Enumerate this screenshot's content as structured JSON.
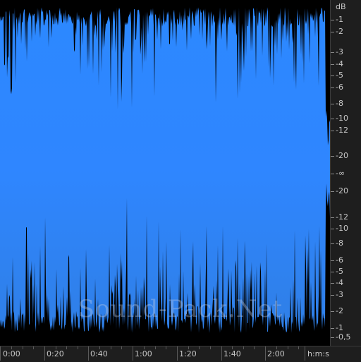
{
  "editor": {
    "watermark": "Sound-Pack.Net",
    "wave_color": "#2f86ff",
    "wave_color_top": "#2c88ff",
    "wave_color_bottom": "#2f7fe6",
    "background_color": "#000000"
  },
  "db_ruler": {
    "unit_label": "dB",
    "upper": [
      "-1",
      "-2",
      "-3",
      "-4",
      "-5",
      "-6",
      "-8",
      "-10",
      "-12",
      "-20"
    ],
    "center": "-∞",
    "lower": [
      "-20",
      "-12",
      "-10",
      "-8",
      "-6",
      "-5",
      "-4",
      "-3",
      "-2",
      "-1",
      "-0,5"
    ]
  },
  "time_ruler": {
    "unit_label": "h:m:s",
    "labels": [
      "0:00",
      "0:20",
      "0:40",
      "1:00",
      "1:20",
      "1:40",
      "2:00"
    ]
  }
}
